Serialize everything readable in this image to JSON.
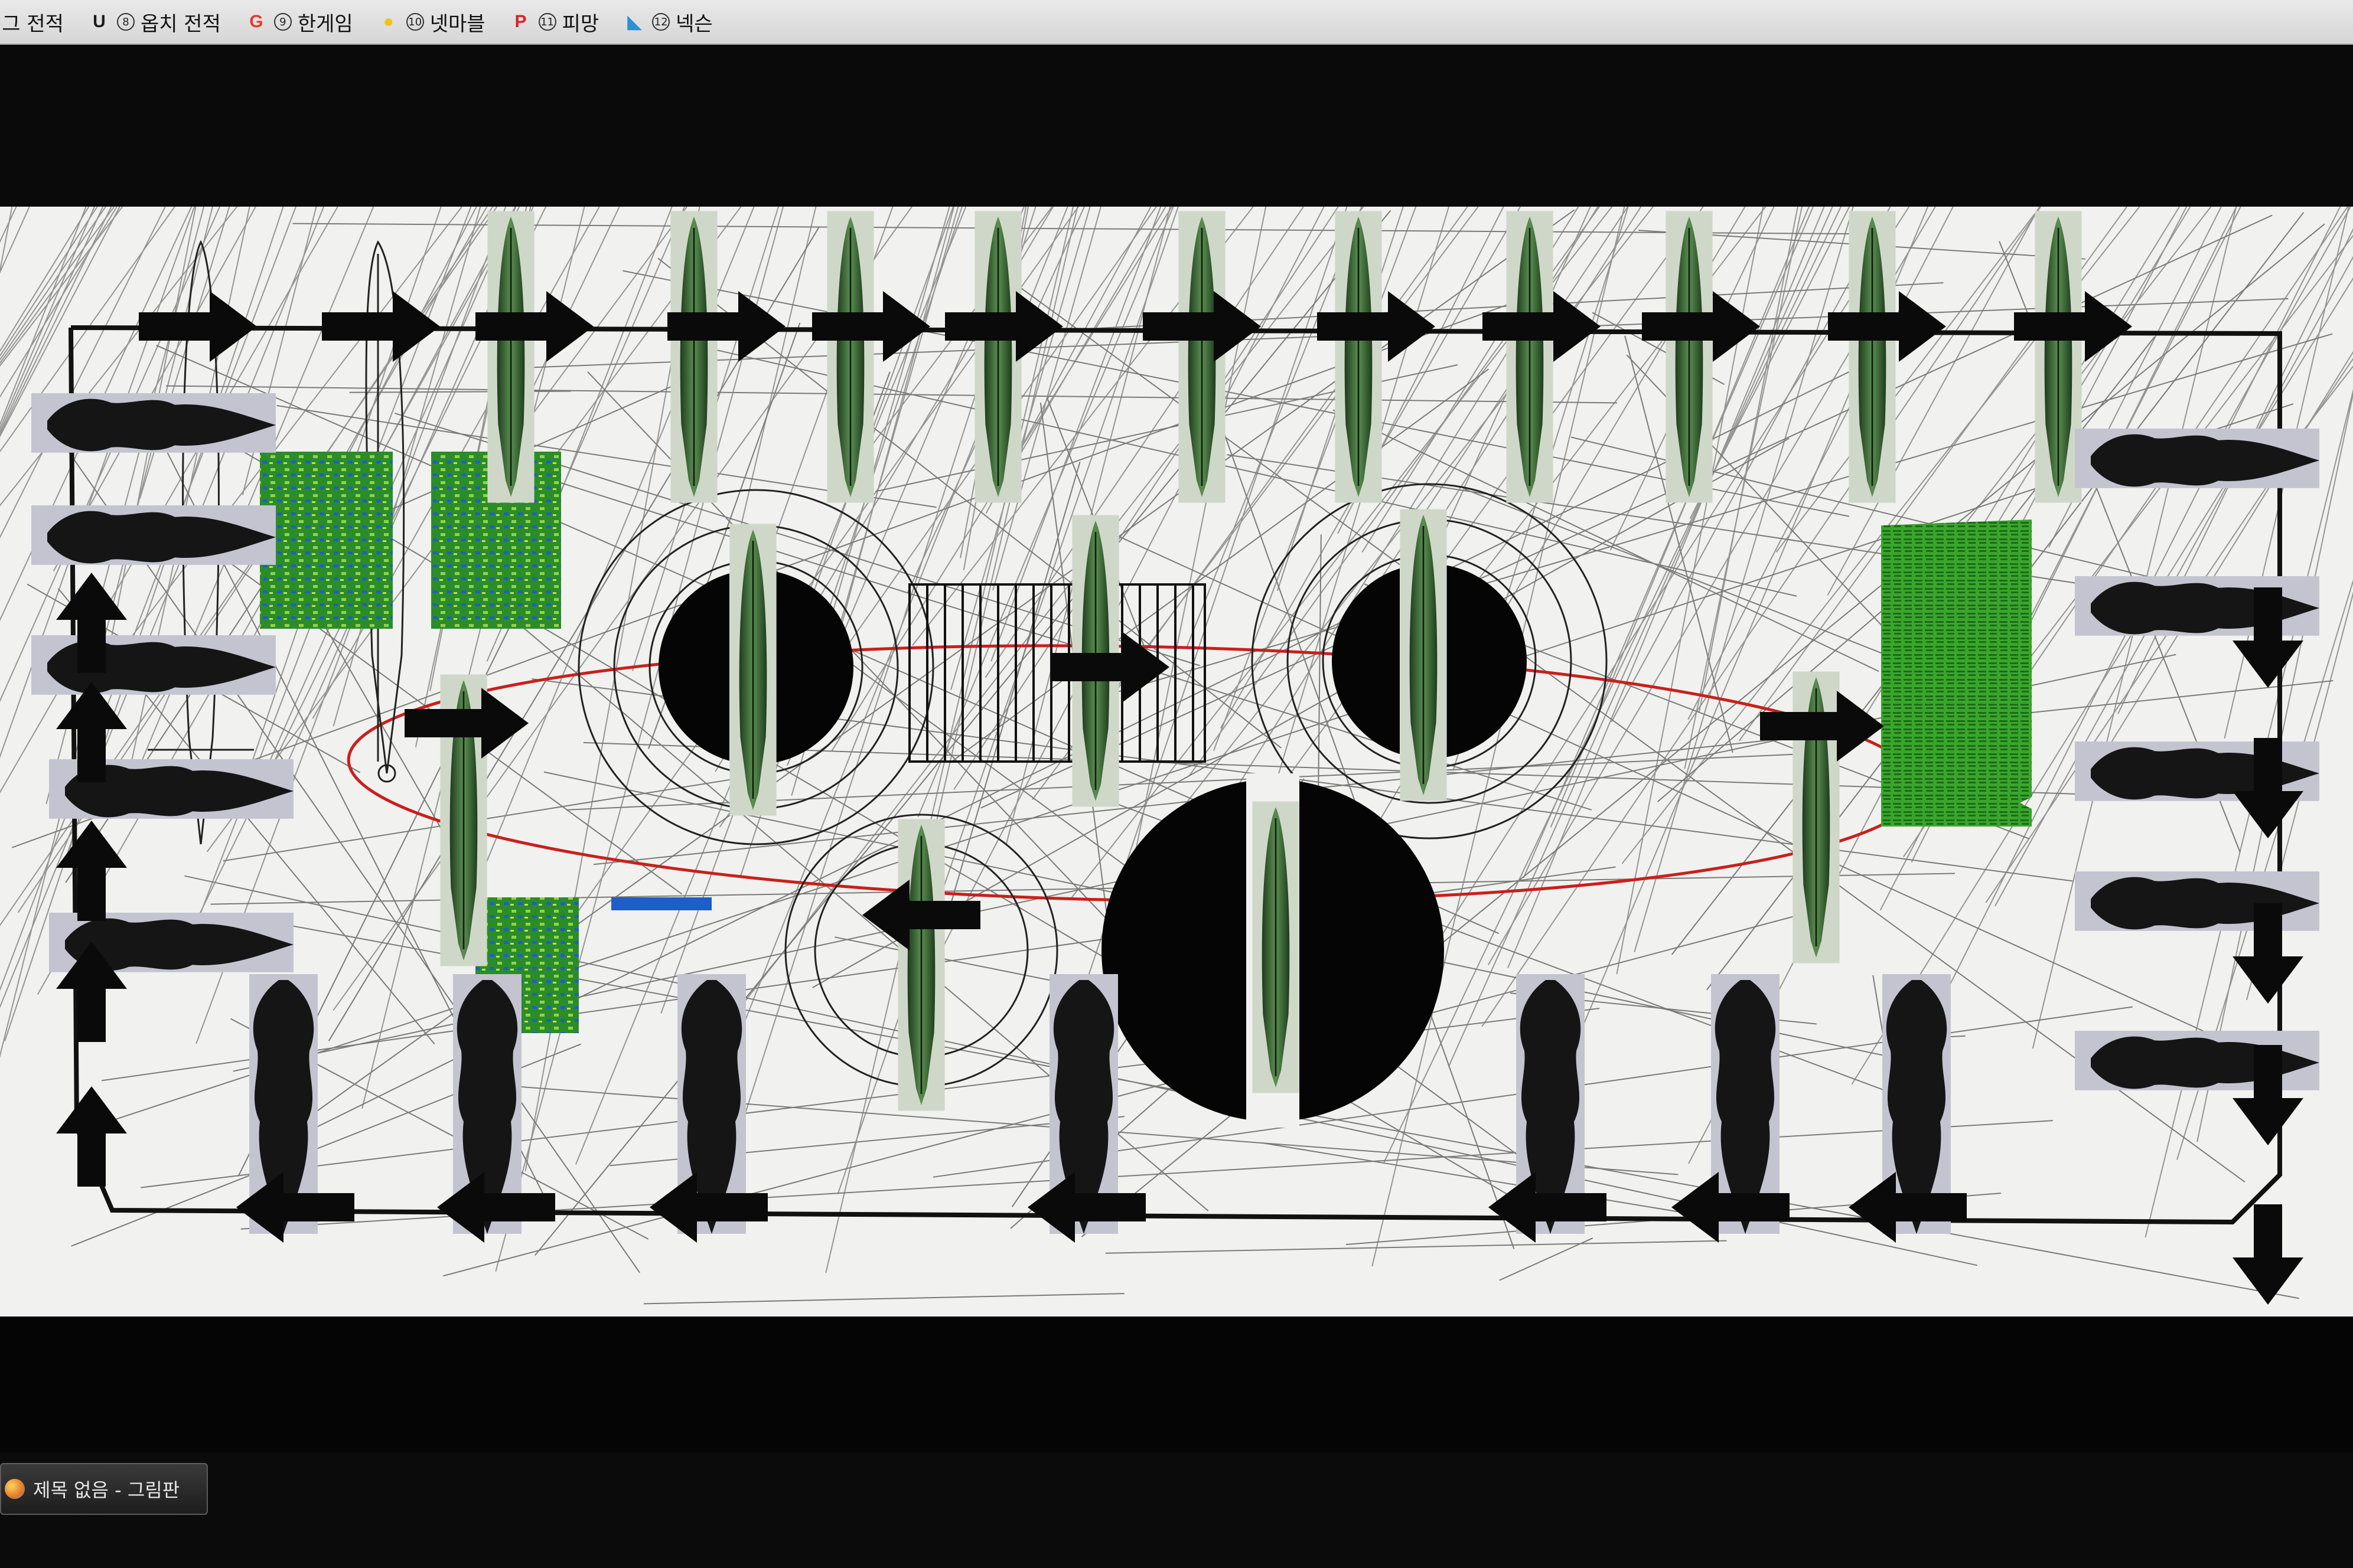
{
  "bookmarks": [
    {
      "icon": "bag-icon",
      "number": "",
      "label": "배그 전적"
    },
    {
      "icon": "u-logo-icon",
      "icon_text": "U",
      "icon_color": "#1b1b1b",
      "number": "8",
      "label": "옵치 전적"
    },
    {
      "icon": "g-logo-icon",
      "icon_text": "G",
      "icon_color": "#e23b2e",
      "number": "9",
      "label": "한게임"
    },
    {
      "icon": "chick-icon",
      "icon_text": "●",
      "icon_color": "#f2c21a",
      "number": "10",
      "label": "넷마블"
    },
    {
      "icon": "p-logo-icon",
      "icon_text": "P",
      "icon_color": "#d8232a",
      "number": "11",
      "label": "피망"
    },
    {
      "icon": "nexon-icon",
      "icon_text": "◣",
      "icon_color": "#2f8fd6",
      "number": "12",
      "label": "넥슨"
    }
  ],
  "taskbar": {
    "app_icon": "paint-icon",
    "window_label": "제목 없음 - 그림판"
  },
  "colors": {
    "canvas_bg": "#f1f1ef",
    "blade_green": "#3f6f3a",
    "blade_dark": "#1a1a1a",
    "matrix_green": "#2c8c2a",
    "ellipse_red": "#c8201c",
    "screen_black": "#050505"
  }
}
